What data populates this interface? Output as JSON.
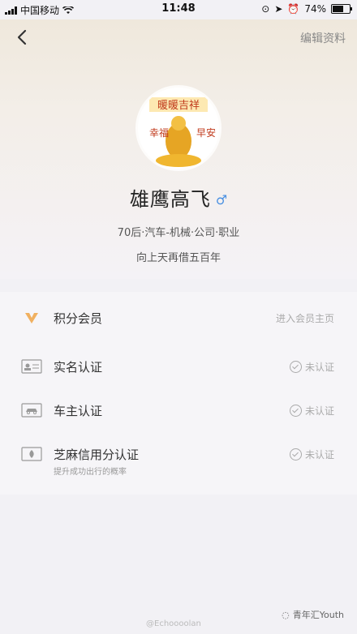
{
  "status_bar": {
    "carrier": "中国移动",
    "time": "11:48",
    "battery": "74%",
    "battery_level": 0.74
  },
  "nav": {
    "edit_label": "编辑资料"
  },
  "avatar": {
    "top_text": "暖暖吉祥",
    "left_text": "幸福",
    "right_text": "早安"
  },
  "profile": {
    "nickname": "雄鹰高飞",
    "gender_symbol": "♂",
    "tags": "70后·汽车-机械·公司·职业",
    "signature": "向上天再借五百年"
  },
  "list": {
    "points": {
      "label": "积分会员",
      "right": "进入会员主页"
    },
    "realname": {
      "label": "实名认证",
      "status": "未认证"
    },
    "owner": {
      "label": "车主认证",
      "status": "未认证"
    },
    "sesame": {
      "label": "芝麻信用分认证",
      "status": "未认证",
      "sub": "提升成功出行的概率"
    }
  },
  "watermark": {
    "weibo": "@Echoooolan",
    "brand": "青年汇Youth"
  },
  "colors": {
    "accent": "#e8a23a",
    "gender": "#4a90e2"
  }
}
